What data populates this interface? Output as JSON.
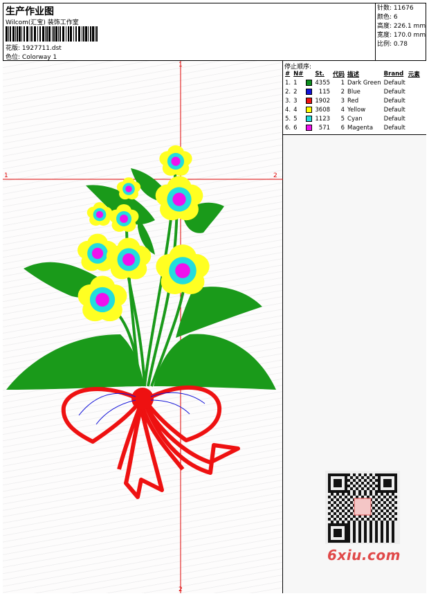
{
  "header": {
    "title": "生产作业图",
    "company": "Wilcom(汇宝) 装饰工作室",
    "design_label": "花版:",
    "design_value": "1927711.dst",
    "colorway_label": "色位:",
    "colorway_value": "Colorway 1"
  },
  "stats": {
    "stitches_label": "针数:",
    "stitches_value": "11676",
    "colors_label": "颜色:",
    "colors_value": "6",
    "height_label": "高度:",
    "height_value": "226.1 mm",
    "width_label": "宽度:",
    "width_value": "170.0 mm",
    "scale_label": "比例:",
    "scale_value": "0.78"
  },
  "stop_sequence": {
    "title": "停止顺序:",
    "columns": [
      "#",
      "N#",
      "St.",
      "代码",
      "描述",
      "Brand",
      "元素"
    ],
    "rows": [
      {
        "idx": "1.",
        "n": "1",
        "code": "4355",
        "color": "#0b8f1e",
        "st": "1",
        "desc": "Dark Green",
        "brand": "Default"
      },
      {
        "idx": "2.",
        "n": "2",
        "code": "115",
        "color": "#1313d8",
        "st": "2",
        "desc": "Blue",
        "brand": "Default"
      },
      {
        "idx": "3.",
        "n": "3",
        "code": "1902",
        "color": "#ee1111",
        "st": "3",
        "desc": "Red",
        "brand": "Default"
      },
      {
        "idx": "4.",
        "n": "4",
        "code": "3608",
        "color": "#ffff00",
        "st": "4",
        "desc": "Yellow",
        "brand": "Default"
      },
      {
        "idx": "5.",
        "n": "5",
        "code": "1123",
        "color": "#22dddd",
        "st": "5",
        "desc": "Cyan",
        "brand": "Default"
      },
      {
        "idx": "6.",
        "n": "6",
        "code": "571",
        "color": "#ee11ee",
        "st": "6",
        "desc": "Magenta",
        "brand": "Default"
      }
    ]
  },
  "axes": {
    "top": "1",
    "bottom": "2",
    "left": "1",
    "right": "2"
  },
  "watermark": {
    "logo_text": "6xiu.com"
  },
  "colors": {
    "guide": "#dd0000",
    "leaf": "#1a9a1a",
    "bow": "#ee1111",
    "petal": "#ffff22",
    "inner": "#22dddd",
    "center": "#ee11ee"
  }
}
